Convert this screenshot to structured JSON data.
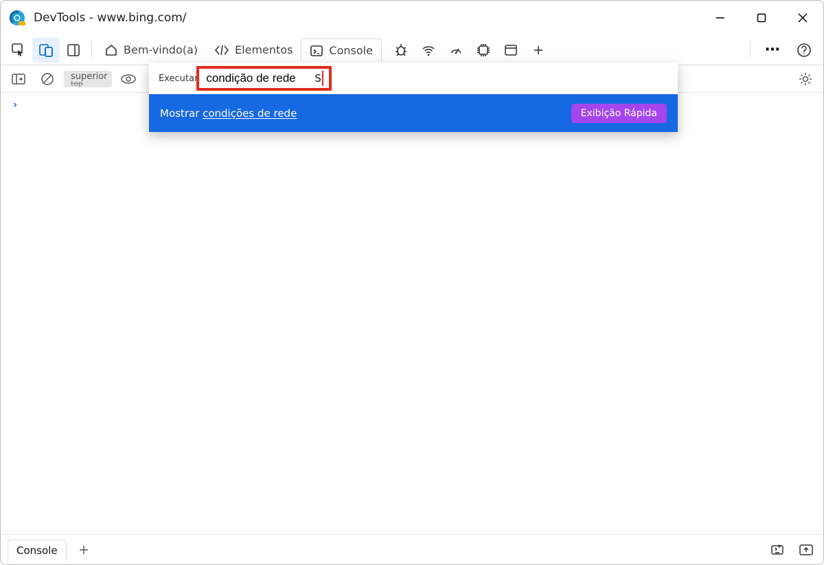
{
  "window": {
    "title": "DevTools - www.bing.com/"
  },
  "tabs": {
    "welcome": "Bem-vindo(a)",
    "elements": "Elementos",
    "console": "Console"
  },
  "subbar": {
    "context_chip": "superior",
    "context_chip_sub": "top"
  },
  "command_menu": {
    "prefix": "Executar",
    "input_value": "condição de rede",
    "trailing": "S",
    "result_prefix": "Mostrar ",
    "result_underlined": "condições de rede",
    "badge": "Exibição Rápida"
  },
  "console_prompt": "›",
  "bottom": {
    "tab": "Console",
    "add": "+"
  },
  "icons": {
    "more": "⋯"
  }
}
